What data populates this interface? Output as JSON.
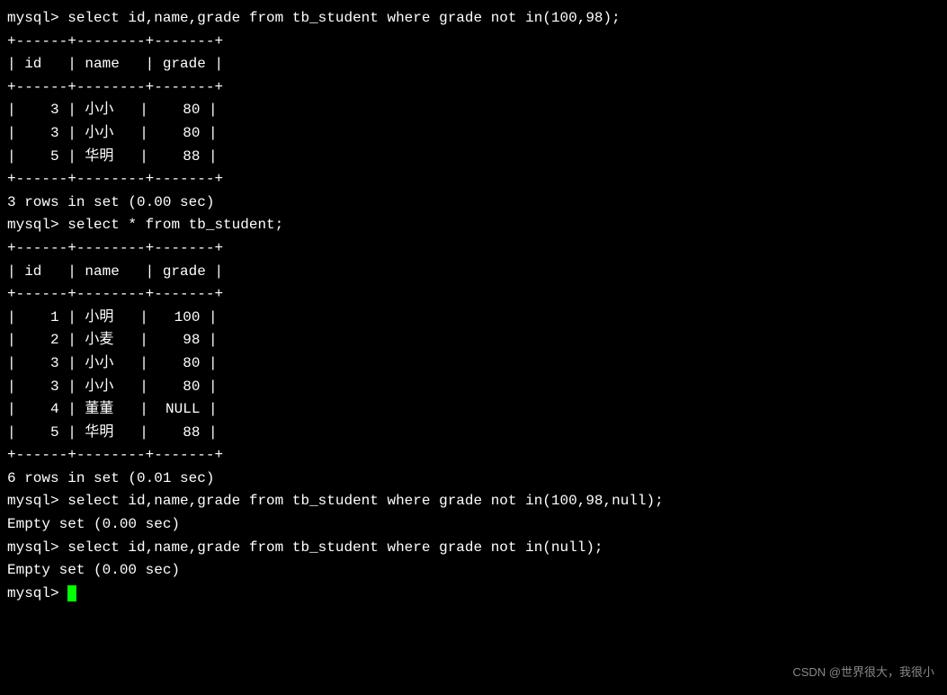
{
  "prompt": "mysql> ",
  "queries": {
    "q1": "select id,name,grade from tb_student where grade not in(100,98);",
    "q2": "select * from tb_student;",
    "q3": "select id,name,grade from tb_student where grade not in(100,98,null);",
    "q4": "select id,name,grade from tb_student where grade not in(null);"
  },
  "table_border": "+------+--------+-------+",
  "table_header": "| id   | name   | grade |",
  "result1": {
    "rows": [
      "|    3 | 小小   |    80 |",
      "|    3 | 小小   |    80 |",
      "|    5 | 华明   |    88 |"
    ],
    "status": "3 rows in set (0.00 sec)"
  },
  "result2": {
    "rows": [
      "|    1 | 小明   |   100 |",
      "|    2 | 小麦   |    98 |",
      "|    3 | 小小   |    80 |",
      "|    3 | 小小   |    80 |",
      "|    4 | 董董   |  NULL |",
      "|    5 | 华明   |    88 |"
    ],
    "status": "6 rows in set (0.01 sec)"
  },
  "result3": {
    "status": "Empty set (0.00 sec)"
  },
  "result4": {
    "status": "Empty set (0.00 sec)"
  },
  "chart_data": {
    "type": "table",
    "tables": [
      {
        "query": "select id,name,grade from tb_student where grade not in(100,98);",
        "columns": [
          "id",
          "name",
          "grade"
        ],
        "rows": [
          {
            "id": 3,
            "name": "小小",
            "grade": 80
          },
          {
            "id": 3,
            "name": "小小",
            "grade": 80
          },
          {
            "id": 5,
            "name": "华明",
            "grade": 88
          }
        ]
      },
      {
        "query": "select * from tb_student;",
        "columns": [
          "id",
          "name",
          "grade"
        ],
        "rows": [
          {
            "id": 1,
            "name": "小明",
            "grade": 100
          },
          {
            "id": 2,
            "name": "小麦",
            "grade": 98
          },
          {
            "id": 3,
            "name": "小小",
            "grade": 80
          },
          {
            "id": 3,
            "name": "小小",
            "grade": 80
          },
          {
            "id": 4,
            "name": "董董",
            "grade": null
          },
          {
            "id": 5,
            "name": "华明",
            "grade": 88
          }
        ]
      }
    ]
  },
  "blank": "",
  "watermark": "CSDN @世界很大，我很小"
}
